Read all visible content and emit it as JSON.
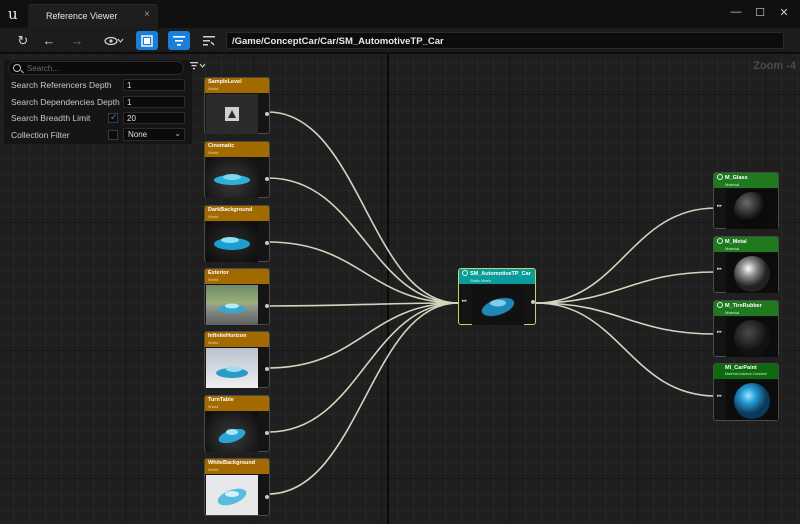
{
  "window": {
    "tab_title": "Reference Viewer",
    "tab_close": "×",
    "min": "—",
    "max": "☐",
    "close": "✕"
  },
  "toolbar": {
    "refresh_icon": "↻",
    "back_icon": "←",
    "forward_icon": "→",
    "view_icon": "👁",
    "path": "/Game/ConceptCar/Car/SM_AutomotiveTP_Car"
  },
  "graph": {
    "zoom_label": "Zoom -4"
  },
  "settings": {
    "search_placeholder": "Search...",
    "rows": [
      {
        "label": "Search Referencers Depth",
        "value": "1"
      },
      {
        "label": "Search Dependencies Depth",
        "value": "1"
      },
      {
        "label": "Search Breadth Limit",
        "value": "20",
        "checked": true
      },
      {
        "label": "Collection Filter",
        "value": "None",
        "checked": false
      }
    ]
  },
  "referencers": [
    {
      "title": "SampleLevel",
      "type": "World"
    },
    {
      "title": "Cinematic",
      "type": "World"
    },
    {
      "title": "DarkBackground",
      "type": "World"
    },
    {
      "title": "Exterior",
      "type": "World"
    },
    {
      "title": "InfiniteHorizon",
      "type": "World"
    },
    {
      "title": "TurnTable",
      "type": "World"
    },
    {
      "title": "WhiteBackground",
      "type": "World"
    }
  ],
  "center": {
    "title": "SM_AutomotiveTP_Car",
    "type": "Static Mesh"
  },
  "dependencies": [
    {
      "title": "M_Glass",
      "type": "Material"
    },
    {
      "title": "M_Metal",
      "type": "Material"
    },
    {
      "title": "M_TireRubber",
      "type": "Material"
    },
    {
      "title": "MI_CarPaint",
      "type": "Material Instance Constant"
    }
  ],
  "colors": {
    "world_header": "#a36a00",
    "mesh_header": "#0a9c9c",
    "material_header": "#1f7a1f",
    "accent": "#1a7fd8"
  }
}
